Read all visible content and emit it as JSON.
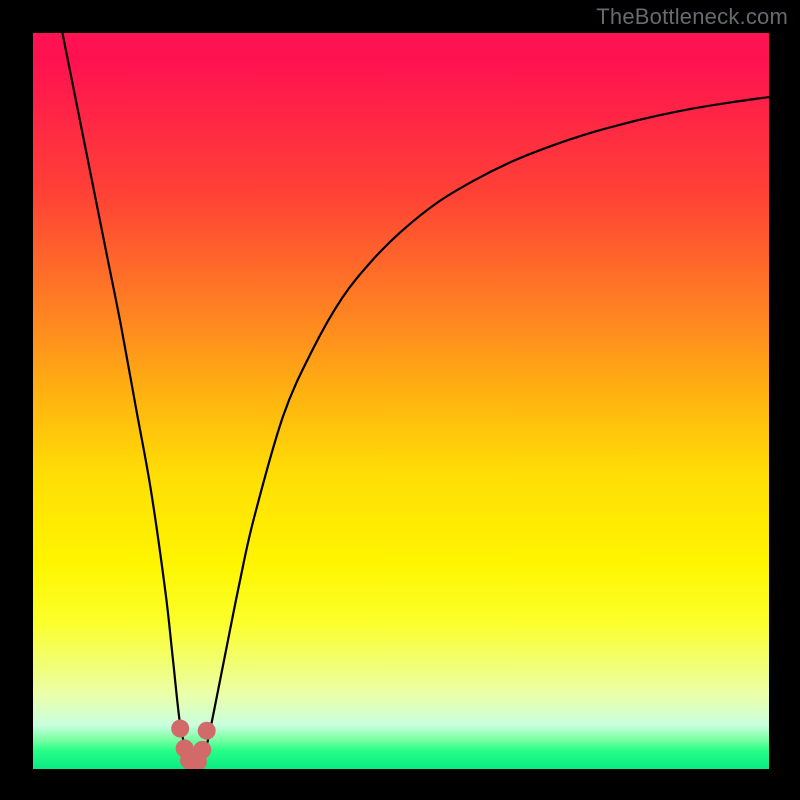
{
  "watermark": "TheBottleneck.com",
  "chart_data": {
    "type": "line",
    "title": "",
    "xlabel": "",
    "ylabel": "",
    "xlim": [
      0,
      100
    ],
    "ylim": [
      0,
      100
    ],
    "grid": false,
    "legend": false,
    "series": [
      {
        "name": "bottleneck-curve",
        "x": [
          4,
          6,
          8,
          10,
          12,
          14,
          16,
          18,
          19,
          20,
          21,
          22,
          23,
          24,
          26,
          28,
          30,
          34,
          38,
          42,
          46,
          50,
          55,
          60,
          65,
          70,
          75,
          80,
          85,
          90,
          95,
          100
        ],
        "values": [
          100,
          90,
          80,
          70,
          60,
          49,
          38,
          24,
          15,
          6,
          2,
          0,
          1,
          5,
          15,
          25,
          34,
          48,
          57,
          64,
          69,
          73,
          77,
          80,
          82.5,
          84.5,
          86.2,
          87.6,
          88.8,
          89.8,
          90.6,
          91.3
        ]
      }
    ],
    "markers": {
      "name": "minimum-highlight",
      "color": "#d36a6a",
      "x": [
        20,
        20.6,
        21.2,
        21.8,
        22.4,
        23,
        23.6
      ],
      "values": [
        5.5,
        2.8,
        1.2,
        0.4,
        1.0,
        2.6,
        5.2
      ]
    },
    "background_gradient_stops": [
      {
        "pos": 0.0,
        "color": "#ff1352"
      },
      {
        "pos": 0.22,
        "color": "#ff4236"
      },
      {
        "pos": 0.4,
        "color": "#ff8b1f"
      },
      {
        "pos": 0.6,
        "color": "#ffde05"
      },
      {
        "pos": 0.8,
        "color": "#fbff2a"
      },
      {
        "pos": 0.94,
        "color": "#c9ffdf"
      },
      {
        "pos": 1.0,
        "color": "#09eb83"
      }
    ]
  }
}
